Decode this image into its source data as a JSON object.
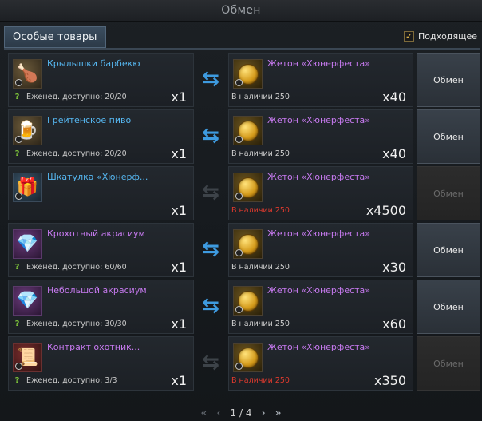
{
  "window": {
    "title": "Обмен"
  },
  "tab": {
    "label": "Особые товары"
  },
  "filter": {
    "label": "Подходящее",
    "checked": true
  },
  "rows": [
    {
      "item": {
        "name": "Крылышки барбекю",
        "icon": "bbq-wings-icon",
        "color": "blue"
      },
      "weekly": "Еженед. доступно: 20/20",
      "qty": "x1",
      "swap_enabled": true,
      "cost": {
        "name": "Жетон «Хюнерфеста»",
        "icon": "coin-icon",
        "stock": "В наличии 250",
        "stock_ok": true,
        "qty": "x40"
      },
      "button": {
        "label": "Обмен",
        "enabled": true
      }
    },
    {
      "item": {
        "name": "Грейтенское пиво",
        "icon": "beer-barrel-icon",
        "color": "blue"
      },
      "weekly": "Еженед. доступно: 20/20",
      "qty": "x1",
      "swap_enabled": true,
      "cost": {
        "name": "Жетон «Хюнерфеста»",
        "icon": "coin-icon",
        "stock": "В наличии 250",
        "stock_ok": true,
        "qty": "x40"
      },
      "button": {
        "label": "Обмен",
        "enabled": true
      }
    },
    {
      "item": {
        "name": "Шкатулка «Хюнерф...",
        "icon": "chest-icon",
        "color": "blue"
      },
      "weekly": "",
      "qty": "x1",
      "swap_enabled": false,
      "cost": {
        "name": "Жетон «Хюнерфеста»",
        "icon": "coin-icon",
        "stock": "В наличии 250",
        "stock_ok": false,
        "qty": "x4500"
      },
      "button": {
        "label": "Обмен",
        "enabled": false
      }
    },
    {
      "item": {
        "name": "Крохотный акрасиум",
        "icon": "crystal-icon",
        "color": "purple"
      },
      "weekly": "Еженед. доступно: 60/60",
      "qty": "x1",
      "swap_enabled": true,
      "cost": {
        "name": "Жетон «Хюнерфеста»",
        "icon": "coin-icon",
        "stock": "В наличии 250",
        "stock_ok": true,
        "qty": "x30"
      },
      "button": {
        "label": "Обмен",
        "enabled": true
      }
    },
    {
      "item": {
        "name": "Небольшой акрасиум",
        "icon": "crystal-icon",
        "color": "purple"
      },
      "weekly": "Еженед. доступно: 30/30",
      "qty": "x1",
      "swap_enabled": true,
      "cost": {
        "name": "Жетон «Хюнерфеста»",
        "icon": "coin-icon",
        "stock": "В наличии 250",
        "stock_ok": true,
        "qty": "x60"
      },
      "button": {
        "label": "Обмен",
        "enabled": true
      }
    },
    {
      "item": {
        "name": "Контракт охотник...",
        "icon": "contract-icon",
        "color": "purple"
      },
      "weekly": "Еженед. доступно: 3/3",
      "qty": "x1",
      "swap_enabled": false,
      "cost": {
        "name": "Жетон «Хюнерфеста»",
        "icon": "coin-icon",
        "stock": "В наличии 250",
        "stock_ok": false,
        "qty": "x350"
      },
      "button": {
        "label": "Обмен",
        "enabled": false
      }
    }
  ],
  "pager": {
    "label": "1 / 4"
  },
  "colors": {
    "blue": "#56b8f2",
    "purple": "#c77af0",
    "out_of_stock": "#e03a2e",
    "swap": "#3e9be0"
  }
}
